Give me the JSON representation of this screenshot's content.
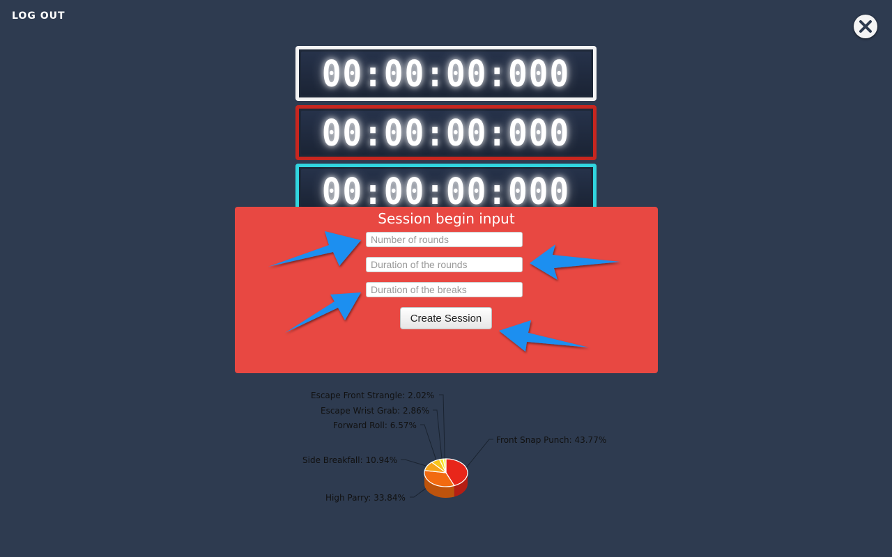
{
  "header": {
    "logout_label": "LOG OUT"
  },
  "timers": {
    "main": "00:00:00:000",
    "round": "00:00:00:000",
    "break": "00:00:00:000",
    "colors": {
      "main": "#f4f4f4",
      "round": "#c8261f",
      "break": "#31d5df"
    }
  },
  "session_form": {
    "title": "Session begin input",
    "rounds_placeholder": "Number of rounds",
    "round_duration_placeholder": "Duration of the rounds",
    "break_duration_placeholder": "Duration of the breaks",
    "submit_label": "Create Session",
    "panel_color": "#e84842"
  },
  "chart_data": {
    "type": "pie",
    "slices": [
      {
        "label": "Front Snap Punch",
        "value": 43.77,
        "text": "Front Snap Punch: 43.77%",
        "color": "#e8261a"
      },
      {
        "label": "High Parry",
        "value": 33.84,
        "text": "High Parry: 33.84%",
        "color": "#f26a10"
      },
      {
        "label": "Side Breakfall",
        "value": 10.94,
        "text": "Side Breakfall: 10.94%",
        "color": "#f5a31a"
      },
      {
        "label": "Forward Roll",
        "value": 6.57,
        "text": "Forward Roll: 6.57%",
        "color": "#f7c51c"
      },
      {
        "label": "Escape Wrist Grab",
        "value": 2.86,
        "text": "Escape Wrist Grab: 2.86%",
        "color": "#f7e02a"
      },
      {
        "label": "Escape Front Strangle",
        "value": 2.02,
        "text": "Escape Front Strangle: 2.02%",
        "color": "#faf04a"
      }
    ]
  }
}
